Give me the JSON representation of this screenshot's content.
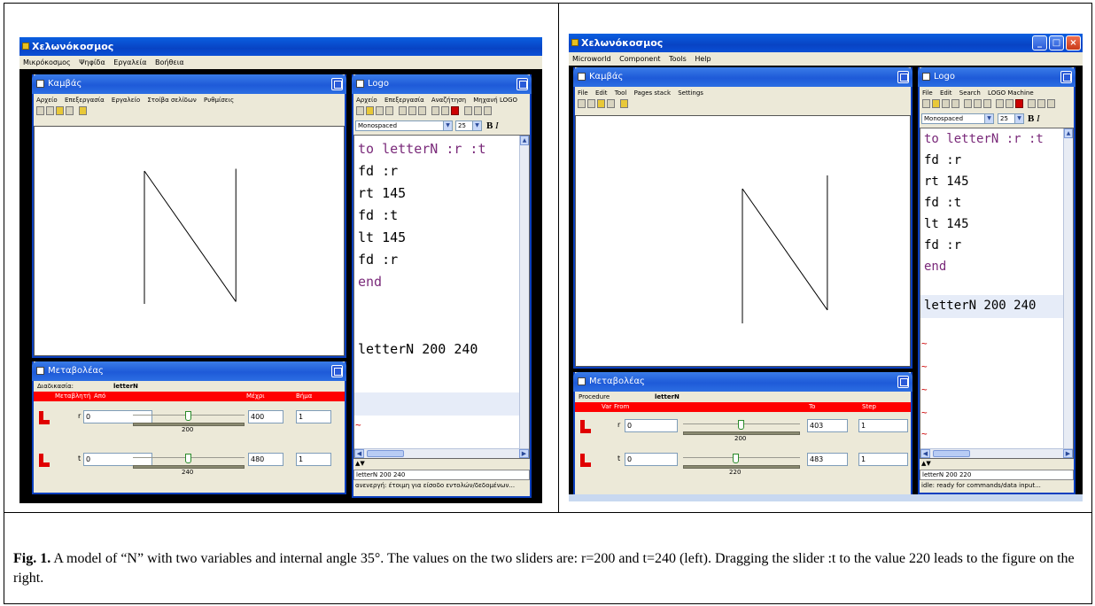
{
  "left": {
    "app_title": "Χελωνόκοσμος",
    "menu": [
      "Μικρόκοσμος",
      "Ψηφίδα",
      "Εργαλεία",
      "Βοήθεια"
    ],
    "canvas_window": {
      "title": "Καμβάς",
      "menu": [
        "Αρχείο",
        "Επεξεργασία",
        "Εργαλείο",
        "Στοίβα σελίδων",
        "Ρυθμίσεις"
      ]
    },
    "logo_window": {
      "title": "Logo",
      "menu": [
        "Αρχείο",
        "Επεξεργασία",
        "Αναζήτηση",
        "Μηχανή LOGO"
      ],
      "font": "Monospaced",
      "font_size": "25",
      "code": [
        "to letterN :r :t",
        "fd :r",
        "rt 145",
        "fd :t",
        "lt 145",
        "fd :r",
        "end"
      ],
      "command": "letterN 200 240",
      "tilde": "~",
      "input": "letterN 200 240",
      "status": "ανενεργή: έτοιμη για είσοδο εντολών/δεδομένων..."
    },
    "variables_window": {
      "title": "Μεταβολέας",
      "procedure_label": "Διαδικασία:",
      "procedure_value": "letterN",
      "col_var": "Μεταβλητή",
      "col_from": "Από",
      "col_to": "Μέχρι",
      "col_step": "Βήμα",
      "vars": [
        {
          "name": "r",
          "from": "0",
          "value": "200",
          "to": "400",
          "step": "1",
          "level": 0.5
        },
        {
          "name": "t",
          "from": "0",
          "value": "240",
          "to": "480",
          "step": "1",
          "level": 0.5
        }
      ]
    },
    "drawing": {
      "r": 200,
      "t": 240,
      "angle": 145
    }
  },
  "right": {
    "app_title": "Χελωνόκοσμος",
    "menu": [
      "Microworld",
      "Component",
      "Tools",
      "Help"
    ],
    "canvas_window": {
      "title": "Καμβάς",
      "menu": [
        "File",
        "Edit",
        "Tool",
        "Pages stack",
        "Settings"
      ]
    },
    "logo_window": {
      "title": "Logo",
      "menu": [
        "File",
        "Edit",
        "Search",
        "LOGO Machine"
      ],
      "font": "Monospaced",
      "font_size": "25",
      "code": [
        "to letterN :r :t",
        "fd :r",
        "rt 145",
        "fd :t",
        "lt 145",
        "fd :r",
        "end"
      ],
      "command": "letterN 200 240",
      "tilde": "~",
      "input": "letterN 200 220",
      "status": "idle: ready for commands/data input..."
    },
    "variables_window": {
      "title": "Μεταβολέας",
      "procedure_label": "Procedure",
      "procedure_value": "letterN",
      "col_var": "Var",
      "col_from": "From",
      "col_to": "To",
      "col_step": "Step",
      "vars": [
        {
          "name": "r",
          "from": "0",
          "value": "200",
          "to": "403",
          "step": "1",
          "level": 0.5
        },
        {
          "name": "t",
          "from": "0",
          "value": "220",
          "to": "483",
          "step": "1",
          "level": 0.455
        }
      ]
    },
    "drawing": {
      "r": 200,
      "t": 220,
      "angle": 145
    }
  },
  "caption": {
    "label": "Fig. 1.",
    "text": " A model of “N” with two variables and internal angle 35°. The values on the two sliders are: r=200 and t=240 (left). Dragging the slider :t to the value 220 leads to the figure on the right."
  }
}
